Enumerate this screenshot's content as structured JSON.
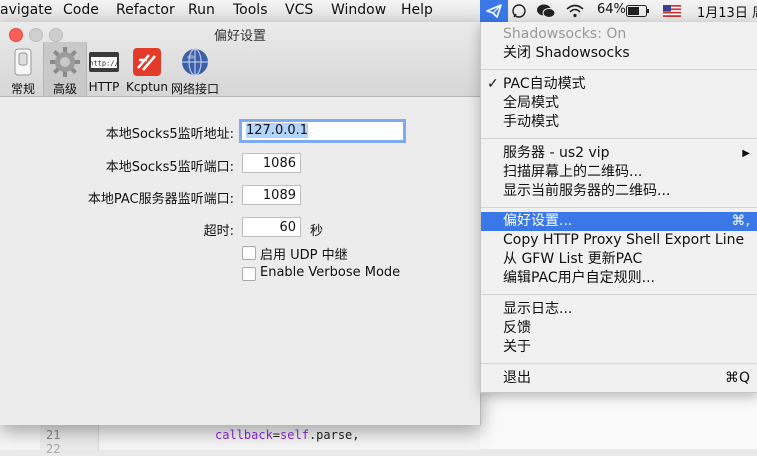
{
  "menubar": {
    "items": [
      "avigate",
      "Code",
      "Refactor",
      "Run",
      "Tools",
      "VCS",
      "Window",
      "Help"
    ],
    "battery": "64%",
    "date": "1月13日 周"
  },
  "editor": {
    "line_number": "21",
    "line_number_next": "22",
    "code_fn": "callback",
    "code_eq": "=",
    "code_self": "self",
    "code_rest": ".parse,"
  },
  "window": {
    "title": "偏好设置",
    "tabs": [
      {
        "label": "常规"
      },
      {
        "label": "高级"
      },
      {
        "label": "HTTP"
      },
      {
        "label": "Kcptun"
      },
      {
        "label": "网络接口"
      }
    ],
    "fields": {
      "socks_addr_label": "本地Socks5监听地址:",
      "socks_addr_value": "127.0.0.1",
      "socks_port_label": "本地Socks5监听端口:",
      "socks_port_value": "1086",
      "pac_port_label": "本地PAC服务器监听端口:",
      "pac_port_value": "1089",
      "timeout_label": "超时:",
      "timeout_value": "60",
      "timeout_unit": "秒"
    },
    "checkboxes": {
      "udp_relay": "启用 UDP 中继",
      "verbose": "Enable Verbose Mode"
    }
  },
  "dropdown": {
    "status": "Shadowsocks: On",
    "toggle": "关闭 Shadowsocks",
    "pac_mode": "PAC自动模式",
    "global_mode": "全局模式",
    "manual_mode": "手动模式",
    "server": "服务器 - us2 vip",
    "scan_qr": "扫描屏幕上的二维码...",
    "show_qr": "显示当前服务器的二维码...",
    "preferences": "偏好设置...",
    "preferences_shortcut": "⌘,",
    "copy_export": "Copy HTTP Proxy Shell Export Line",
    "update_pac": "从 GFW List 更新PAC",
    "edit_pac": "编辑PAC用户自定规则...",
    "show_log": "显示日志...",
    "feedback": "反馈",
    "about": "关于",
    "quit": "退出",
    "quit_shortcut": "⌘Q"
  }
}
